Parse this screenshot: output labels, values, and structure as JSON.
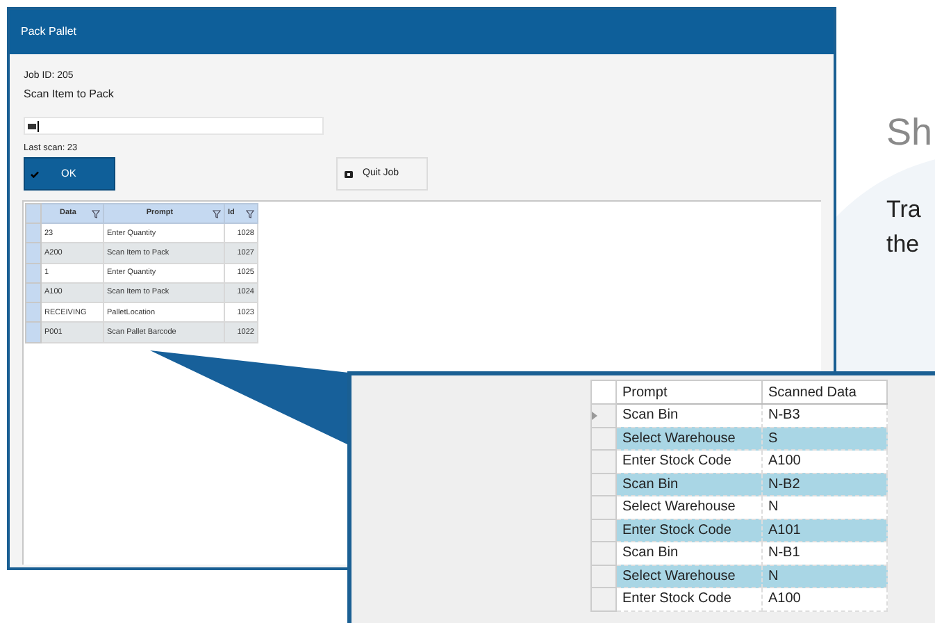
{
  "page": {
    "heading": "Sh",
    "lines": [
      "Tra",
      "the"
    ]
  },
  "window": {
    "title": "Pack Pallet",
    "job_id": "Job ID: 205",
    "instruction": "Scan Item to Pack",
    "last_scan": "Last scan: 23",
    "buttons": [
      {
        "label": "OK",
        "kind": "primary"
      },
      {
        "label": "Quit Job",
        "kind": "secondary"
      }
    ],
    "grid": {
      "columns": [
        "Data",
        "Prompt",
        "Id"
      ],
      "rows": [
        {
          "cells": [
            "23",
            "Enter Quantity",
            "1028"
          ]
        },
        {
          "cells": [
            "A200",
            "Scan Item to Pack",
            "1027"
          ]
        },
        {
          "cells": [
            "1",
            "Enter Quantity",
            "1025"
          ]
        },
        {
          "cells": [
            "A100",
            "Scan Item to Pack",
            "1024"
          ]
        },
        {
          "cells": [
            "RECEIVING",
            "PalletLocation",
            "1023"
          ]
        },
        {
          "cells": [
            "P001",
            "Scan Pallet Barcode",
            "1022"
          ]
        }
      ]
    }
  },
  "callout_grid": {
    "columns": [
      "Prompt",
      "Scanned Data"
    ],
    "rows": [
      {
        "cells": [
          "Scan Bin",
          "N-B3"
        ],
        "current": true,
        "highlighted": false
      },
      {
        "cells": [
          "Select Warehouse",
          "S"
        ],
        "current": false,
        "highlighted": true
      },
      {
        "cells": [
          "Enter Stock Code",
          "A100"
        ],
        "current": false,
        "highlighted": false
      },
      {
        "cells": [
          "Scan Bin",
          "N-B2"
        ],
        "current": false,
        "highlighted": true
      },
      {
        "cells": [
          "Select Warehouse",
          "N"
        ],
        "current": false,
        "highlighted": false
      },
      {
        "cells": [
          "Enter Stock Code",
          "A101"
        ],
        "current": false,
        "highlighted": true
      },
      {
        "cells": [
          "Scan Bin",
          "N-B1"
        ],
        "current": false,
        "highlighted": false
      },
      {
        "cells": [
          "Select Warehouse",
          "N"
        ],
        "current": false,
        "highlighted": true
      },
      {
        "cells": [
          "Enter Stock Code",
          "A100"
        ],
        "current": false,
        "highlighted": false
      }
    ]
  }
}
